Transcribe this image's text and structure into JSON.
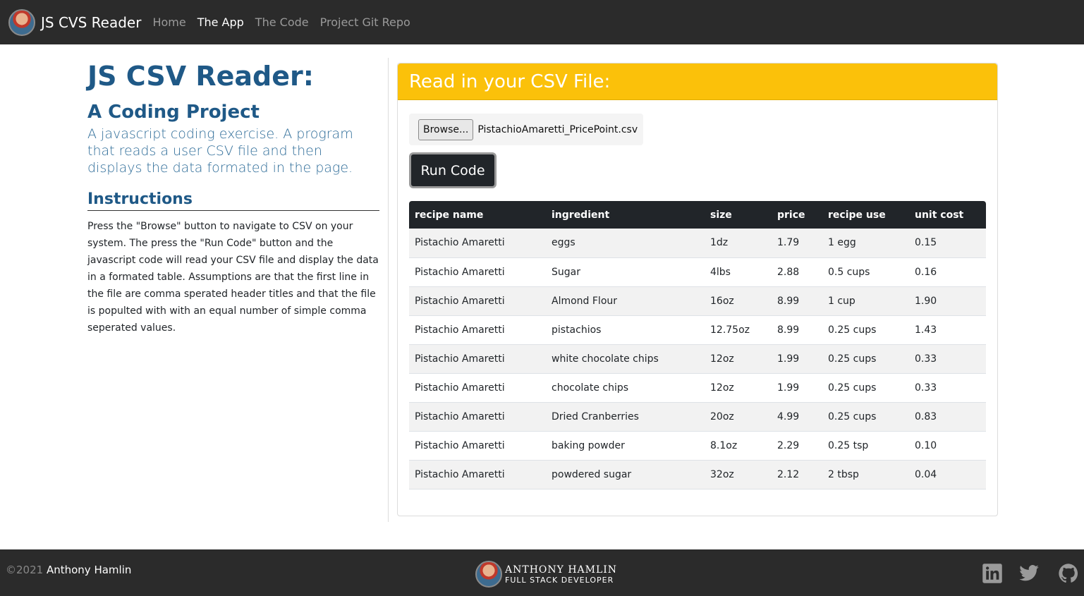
{
  "navbar": {
    "brand": "JS CVS Reader",
    "links": [
      {
        "label": "Home",
        "active": false
      },
      {
        "label": "The App",
        "active": true
      },
      {
        "label": "The Code",
        "active": false
      },
      {
        "label": "Project Git Repo",
        "active": false
      }
    ]
  },
  "left": {
    "title": "JS CSV Reader:",
    "subtitle": "A Coding Project",
    "lead": "A javascript coding exercise. A program that reads a user CSV file and then displays the data formated in the page.",
    "instructions_heading": "Instructions",
    "instructions_body": "Press the \"Browse\" button to navigate to CSV on your system. The press the \"Run Code\" button and the javascript code will read your CSV file and display the data in a formated table. Assumptions are that the first line in the file are comma sperated header titles and that the file is populted with with an equal number of simple comma seperated values."
  },
  "card": {
    "header": "Read in your CSV File:",
    "browse_label": "Browse...",
    "file_name": "PistachioAmaretti_PricePoint.csv",
    "run_label": "Run Code"
  },
  "table": {
    "columns": [
      "recipe name",
      "ingredient",
      "size",
      "price",
      "recipe use",
      "unit cost"
    ],
    "rows": [
      [
        "Pistachio Amaretti",
        "eggs",
        "1dz",
        "1.79",
        "1 egg",
        "0.15"
      ],
      [
        "Pistachio Amaretti",
        "Sugar",
        "4lbs",
        "2.88",
        "0.5 cups",
        "0.16"
      ],
      [
        "Pistachio Amaretti",
        "Almond Flour",
        "16oz",
        "8.99",
        "1 cup",
        "1.90"
      ],
      [
        "Pistachio Amaretti",
        "pistachios",
        "12.75oz",
        "8.99",
        "0.25 cups",
        "1.43"
      ],
      [
        "Pistachio Amaretti",
        "white chocolate chips",
        "12oz",
        "1.99",
        "0.25 cups",
        "0.33"
      ],
      [
        "Pistachio Amaretti",
        "chocolate chips",
        "12oz",
        "1.99",
        "0.25 cups",
        "0.33"
      ],
      [
        "Pistachio Amaretti",
        "Dried Cranberries",
        "20oz",
        "4.99",
        "0.25 cups",
        "0.83"
      ],
      [
        "Pistachio Amaretti",
        "baking powder",
        "8.1oz",
        "2.29",
        "0.25 tsp",
        "0.10"
      ],
      [
        "Pistachio Amaretti",
        "powdered sugar",
        "32oz",
        "2.12",
        "2 tbsp",
        "0.04"
      ]
    ]
  },
  "footer": {
    "copyright": "©2021",
    "author": "Anthony Hamlin",
    "logo_name": "ANTHONY HAMLIN",
    "logo_role": "FULL STACK DEVELOPER",
    "social": [
      "linkedin-icon",
      "twitter-icon",
      "github-icon"
    ]
  },
  "colors": {
    "navbar": "#2b2b2b",
    "heading": "#1f5987",
    "card_header": "#fbc10a",
    "table_header": "#212529"
  }
}
